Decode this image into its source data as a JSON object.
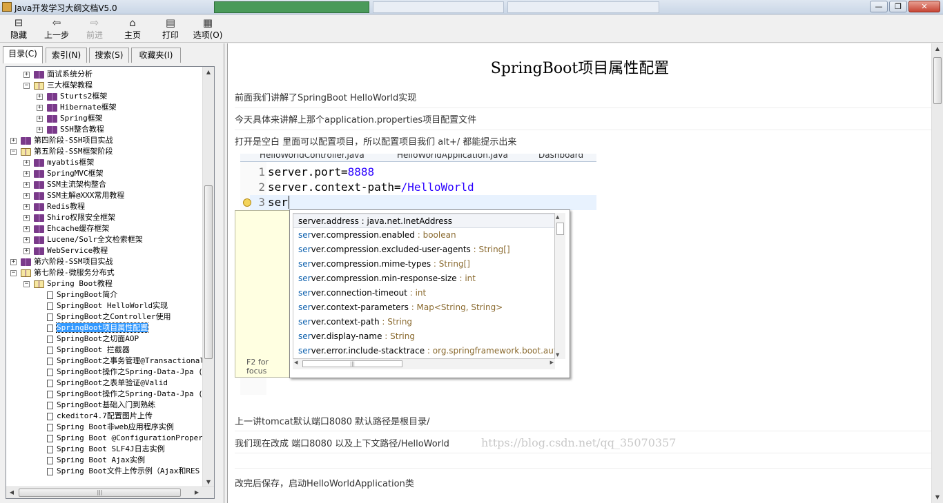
{
  "window": {
    "title": "Java开发学习大纲文档V5.0",
    "controls": [
      "—",
      "❐",
      "✕"
    ]
  },
  "toolbar": {
    "items": [
      {
        "label": "隐藏",
        "icon": "hide-icon"
      },
      {
        "label": "上一步",
        "icon": "back-arrow-icon"
      },
      {
        "label": "前进",
        "icon": "forward-arrow-icon",
        "disabled": true
      },
      {
        "label": "主页",
        "icon": "home-icon"
      },
      {
        "label": "打印",
        "icon": "printer-icon"
      },
      {
        "label": "选项(O)",
        "icon": "options-icon"
      }
    ]
  },
  "sidebar": {
    "tabs": [
      {
        "label": "目录(C)",
        "active": true
      },
      {
        "label": "索引(N)",
        "active": false
      },
      {
        "label": "搜索(S)",
        "active": false
      },
      {
        "label": "收藏夹(I)",
        "active": false
      }
    ],
    "tree": [
      {
        "level": 1,
        "toggle": "+",
        "icon": "book",
        "label": "面试系统分析"
      },
      {
        "level": 1,
        "toggle": "−",
        "icon": "book-open",
        "label": "三大框架教程"
      },
      {
        "level": 2,
        "toggle": "+",
        "icon": "book",
        "label": "Sturts2框架"
      },
      {
        "level": 2,
        "toggle": "+",
        "icon": "book",
        "label": "Hibernate框架"
      },
      {
        "level": 2,
        "toggle": "+",
        "icon": "book",
        "label": "Spring框架"
      },
      {
        "level": 2,
        "toggle": "+",
        "icon": "book",
        "label": "SSH整合教程"
      },
      {
        "level": 0,
        "toggle": "+",
        "icon": "book",
        "label": "第四阶段-SSH项目实战"
      },
      {
        "level": 0,
        "toggle": "−",
        "icon": "book-open",
        "label": "第五阶段-SSM框架阶段"
      },
      {
        "level": 1,
        "toggle": "+",
        "icon": "book",
        "label": "myabtis框架"
      },
      {
        "level": 1,
        "toggle": "+",
        "icon": "book",
        "label": "SpringMVC框架"
      },
      {
        "level": 1,
        "toggle": "+",
        "icon": "book",
        "label": "SSM主流架构整合"
      },
      {
        "level": 1,
        "toggle": "+",
        "icon": "book",
        "label": "SSM主解@XXX常用教程"
      },
      {
        "level": 1,
        "toggle": "+",
        "icon": "book",
        "label": "Redis教程"
      },
      {
        "level": 1,
        "toggle": "+",
        "icon": "book",
        "label": "Shiro权限安全框架"
      },
      {
        "level": 1,
        "toggle": "+",
        "icon": "book",
        "label": "Ehcache缓存框架"
      },
      {
        "level": 1,
        "toggle": "+",
        "icon": "book",
        "label": "Lucene/Solr全文检索框架"
      },
      {
        "level": 1,
        "toggle": "+",
        "icon": "book",
        "label": "WebService教程"
      },
      {
        "level": 0,
        "toggle": "+",
        "icon": "book",
        "label": "第六阶段-SSM项目实战"
      },
      {
        "level": 0,
        "toggle": "−",
        "icon": "book-open",
        "label": "第七阶段-微服务分布式"
      },
      {
        "level": 1,
        "toggle": "−",
        "icon": "book-open",
        "label": "Spring Boot教程"
      },
      {
        "level": 2,
        "icon": "page",
        "label": "SpringBoot简介"
      },
      {
        "level": 2,
        "icon": "page",
        "label": "SpringBoot HelloWorld实现"
      },
      {
        "level": 2,
        "icon": "page",
        "label": "SpringBoot之Controller使用"
      },
      {
        "level": 2,
        "icon": "page",
        "label": "SpringBoot项目属性配置",
        "selected": true
      },
      {
        "level": 2,
        "icon": "page",
        "label": "SpringBoot之切面AOP"
      },
      {
        "level": 2,
        "icon": "page",
        "label": "SpringBoot 拦截器"
      },
      {
        "level": 2,
        "icon": "page",
        "label": "SpringBoot之事务管理@Transactional"
      },
      {
        "level": 2,
        "icon": "page",
        "label": "SpringBoot操作之Spring-Data-Jpa (-"
      },
      {
        "level": 2,
        "icon": "page",
        "label": "SpringBoot之表单验证@Valid"
      },
      {
        "level": 2,
        "icon": "page",
        "label": "SpringBoot操作之Spring-Data-Jpa (二"
      },
      {
        "level": 2,
        "icon": "page",
        "label": "SpringBoot基础入门到熟练"
      },
      {
        "level": 2,
        "icon": "page",
        "label": "ckeditor4.7配置图片上传"
      },
      {
        "level": 2,
        "icon": "page",
        "label": "Spring Boot非web应用程序实例"
      },
      {
        "level": 2,
        "icon": "page",
        "label": "Spring Boot @ConfigurationPropertie"
      },
      {
        "level": 2,
        "icon": "page",
        "label": "Spring Boot SLF4J日志实例"
      },
      {
        "level": 2,
        "icon": "page",
        "label": "Spring Boot Ajax实例"
      },
      {
        "level": 2,
        "icon": "page",
        "label": "Spring Boot文件上传示例（Ajax和RES"
      }
    ]
  },
  "article": {
    "title": "SpringBoot项目属性配置",
    "paragraphs_top": [
      "前面我们讲解了SpringBoot HelloWorld实现",
      "今天具体来讲解上那个application.properties项目配置文件",
      "打开是空白 里面可以配置项目，所以配置项目我们 alt+/ 都能提示出来"
    ],
    "paragraphs_bottom": [
      "上一讲tomcat默认端口8080 默认路径是根目录/",
      "我们现在改成 端口8080 以及上下文路径/HelloWorld",
      "改完后保存，启动HelloWorldApplication类"
    ]
  },
  "screenshot": {
    "editor_tabs": [
      "HelloWorldController.java",
      "HelloWorldApplication.java",
      "Dashboard"
    ],
    "code": [
      {
        "n": "1",
        "key": "server.port=",
        "val": "8888"
      },
      {
        "n": "2",
        "key": "server.context-path=",
        "val": "/HelloWorld"
      },
      {
        "n": "3",
        "key": "ser",
        "val": ""
      }
    ],
    "focus_hint": "F2 for focus",
    "suggestions": [
      {
        "prefix": "ser",
        "rest": "ver.address",
        "type": " : java.net.InetAddress",
        "selected": true
      },
      {
        "prefix": "ser",
        "rest": "ver.compression.enabled",
        "type": " : boolean"
      },
      {
        "prefix": "ser",
        "rest": "ver.compression.excluded-user-agents",
        "type": " : String[]"
      },
      {
        "prefix": "ser",
        "rest": "ver.compression.mime-types",
        "type": " : String[]"
      },
      {
        "prefix": "ser",
        "rest": "ver.compression.min-response-size",
        "type": " : int"
      },
      {
        "prefix": "ser",
        "rest": "ver.connection-timeout",
        "type": " : int"
      },
      {
        "prefix": "ser",
        "rest": "ver.context-parameters",
        "type": " : Map<String, String>"
      },
      {
        "prefix": "ser",
        "rest": "ver.context-path",
        "type": " : String"
      },
      {
        "prefix": "ser",
        "rest": "ver.display-name",
        "type": " : String"
      },
      {
        "prefix": "ser",
        "rest": "ver.error.include-stacktrace",
        "type": " : org.springframework.boot.autc"
      }
    ]
  },
  "watermark": "https://blog.csdn.net/qq_35070357"
}
